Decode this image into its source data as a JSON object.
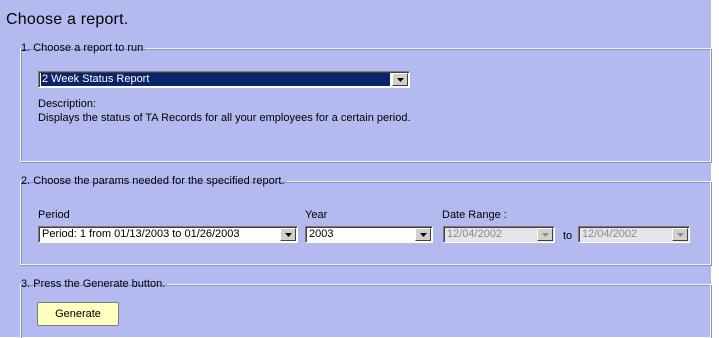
{
  "page_title": "Choose a report.",
  "section1": {
    "legend": "1. Choose a report to run",
    "report_select": {
      "value": "2 Week Status Report"
    },
    "description_label": "Description:",
    "description_text": "Displays the status of TA Records for all your employees for a certain period."
  },
  "section2": {
    "legend": "2. Choose the params needed for the specified report.",
    "period": {
      "label": "Period",
      "value": "Period: 1 from 01/13/2003 to 01/26/2003"
    },
    "year": {
      "label": "Year",
      "value": "2003"
    },
    "date_range": {
      "label": "Date Range :",
      "from": "12/04/2002",
      "to_label": "to",
      "to": "12/04/2002"
    }
  },
  "section3": {
    "legend": "3. Press the Generate button.",
    "generate_label": "Generate"
  },
  "colors": {
    "background": "#b4b9f0",
    "selection": "#0a246a",
    "button": "#ffffc0"
  }
}
